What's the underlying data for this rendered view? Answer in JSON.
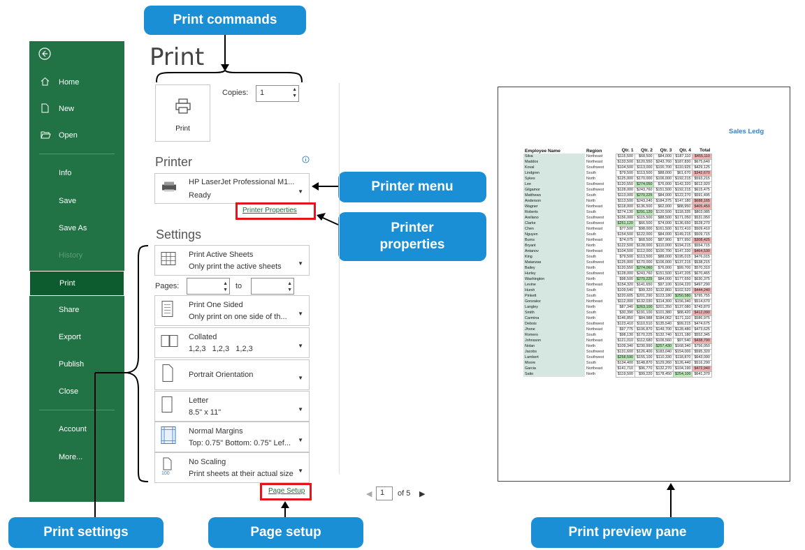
{
  "callouts": {
    "print_commands": "Print commands",
    "printer_menu": "Printer menu",
    "printer_properties": "Printer\nproperties",
    "print_settings": "Print settings",
    "page_setup": "Page setup",
    "print_preview_pane": "Print preview pane"
  },
  "sidebar": {
    "back_icon": "back-arrow-icon",
    "items": [
      {
        "label": "Home",
        "icon": "home-icon"
      },
      {
        "label": "New",
        "icon": "new-document-icon"
      },
      {
        "label": "Open",
        "icon": "open-folder-icon"
      },
      {
        "label": "Info"
      },
      {
        "label": "Save"
      },
      {
        "label": "Save As"
      },
      {
        "label": "History"
      },
      {
        "label": "Print"
      },
      {
        "label": "Share"
      },
      {
        "label": "Export"
      },
      {
        "label": "Publish"
      },
      {
        "label": "Close"
      },
      {
        "label": "Account"
      },
      {
        "label": "More..."
      }
    ],
    "selected": "Print"
  },
  "main": {
    "title": "Print",
    "print_button_label": "Print",
    "copies_label": "Copies:",
    "copies_value": "1"
  },
  "printer": {
    "section_title": "Printer",
    "name": "HP LaserJet Professional M1...",
    "status": "Ready",
    "properties_link": "Printer Properties"
  },
  "settings": {
    "section_title": "Settings",
    "what": {
      "t1": "Print Active Sheets",
      "t2": "Only print the active sheets"
    },
    "pages_label": "Pages:",
    "to_label": "to",
    "sided": {
      "t1": "Print One Sided",
      "t2": "Only print on one side of th..."
    },
    "collated": {
      "t1": "Collated",
      "t2": "1,2,3   1,2,3   1,2,3"
    },
    "orientation": {
      "t1": "Portrait Orientation"
    },
    "paper": {
      "t1": "Letter",
      "t2": "8.5\" x 11\""
    },
    "margins": {
      "t1": "Normal Margins",
      "t2": "Top: 0.75\" Bottom: 0.75\" Lef..."
    },
    "scaling": {
      "t1": "No Scaling",
      "t2": "Print sheets at their actual size",
      "icon_num": "100"
    },
    "page_setup_link": "Page Setup"
  },
  "preview": {
    "page_current": "1",
    "page_total": "of 5",
    "sheet_title": "Sales Ledg",
    "headers": [
      "Employee Name",
      "Region",
      "Qtr. 1",
      "Qtr. 2",
      "Qtr. 3",
      "Qtr. 4",
      "Total"
    ],
    "rows": [
      [
        "Silva",
        "Northeast",
        "$115,500",
        "$68,500",
        "$84,000",
        "$187,110",
        "$455,110"
      ],
      [
        "Maddox",
        "Northeast",
        "$133,500",
        "$120,550",
        "$243,760",
        "$187,830",
        "$675,640"
      ],
      [
        "Koval",
        "Southwest",
        "$104,500",
        "$113,000",
        "$100,700",
        "$110,925",
        "$429,125"
      ],
      [
        "Lindgren",
        "South",
        "$79,500",
        "$113,500",
        "$88,000",
        "$61,670",
        "$342,670"
      ],
      [
        "Sykes",
        "North",
        "$125,000",
        "$170,000",
        "$106,000",
        "$192,215",
        "$593,215"
      ],
      [
        "Lee",
        "Southwest",
        "$120,550",
        "$274,050",
        "$76,000",
        "$142,320",
        "$612,920"
      ],
      [
        "Gilgamor",
        "Southwest",
        "$128,000",
        "$243,760",
        "$151,500",
        "$192,215",
        "$615,475"
      ],
      [
        "Matthews",
        "South",
        "$113,000",
        "$270,225",
        "$84,000",
        "$122,270",
        "$591,495"
      ],
      [
        "Anderson",
        "North",
        "$113,500",
        "$243,240",
        "$184,375",
        "$147,180",
        "$688,165"
      ],
      [
        "Wagner",
        "Northeast",
        "$118,000",
        "$136,500",
        "$62,000",
        "$88,950",
        "$405,450"
      ],
      [
        "Roberts",
        "South",
        "$274,130",
        "$291,120",
        "$120,500",
        "$118,335",
        "$803,085"
      ],
      [
        "Arellano",
        "Southwest",
        "$156,000",
        "$115,500",
        "$88,500",
        "$171,050",
        "$531,050"
      ],
      [
        "Clarke",
        "Southwest",
        "$251,120",
        "$66,500",
        "$74,000",
        "$136,650",
        "$528,270"
      ],
      [
        "Chen",
        "Northeast",
        "$77,500",
        "$98,000",
        "$161,500",
        "$172,410",
        "$509,410"
      ],
      [
        "Nguyen",
        "South",
        "$154,500",
        "$122,000",
        "$84,000",
        "$149,215",
        "$509,715"
      ],
      [
        "Burns",
        "Northeast",
        "$74,075",
        "$68,500",
        "$87,900",
        "$77,950",
        "$308,425"
      ],
      [
        "Bryant",
        "North",
        "$122,500",
        "$128,000",
        "$110,000",
        "$194,215",
        "$554,715"
      ],
      [
        "Antanov",
        "Northeast",
        "$104,500",
        "$112,000",
        "$100,700",
        "$147,330",
        "$464,530"
      ],
      [
        "King",
        "South",
        "$79,500",
        "$113,500",
        "$88,000",
        "$195,015",
        "$476,015"
      ],
      [
        "Matanzas",
        "Southwest",
        "$125,000",
        "$170,000",
        "$106,000",
        "$137,215",
        "$538,215"
      ],
      [
        "Bailey",
        "North",
        "$120,550",
        "$274,060",
        "$76,000",
        "$99,700",
        "$570,310"
      ],
      [
        "Hurley",
        "Southwest",
        "$128,000",
        "$243,760",
        "$151,500",
        "$147,205",
        "$670,465"
      ],
      [
        "Washington",
        "North",
        "$98,500",
        "$270,225",
        "$84,000",
        "$177,650",
        "$630,375"
      ],
      [
        "Levine",
        "Northeast",
        "$154,320",
        "$141,650",
        "$97,100",
        "$104,220",
        "$497,290"
      ],
      [
        "Hursh",
        "South",
        "$109,540",
        "$99,320",
        "$132,860",
        "$102,520",
        "$444,240"
      ],
      [
        "Pinkett",
        "South",
        "$220,605",
        "$201,290",
        "$123,180",
        "$250,580",
        "$795,755"
      ],
      [
        "Gonzalez",
        "Northeast",
        "$112,000",
        "$132,030",
        "$114,300",
        "$156,340",
        "$514,670"
      ],
      [
        "Langley",
        "North",
        "$87,340",
        "$263,100",
        "$201,350",
        "$137,080",
        "$743,870"
      ],
      [
        "Smith",
        "South",
        "$30,390",
        "$191,100",
        "$101,380",
        "$88,420",
        "$412,090"
      ],
      [
        "Carmina",
        "North",
        "$146,850",
        "$84,988",
        "$184,062",
        "$171,110",
        "$586,975"
      ],
      [
        "Debois",
        "Southwest",
        "$123,410",
        "$110,510",
        "$135,540",
        "$99,215",
        "$474,675"
      ],
      [
        "Jhone",
        "Northeast",
        "$97,775",
        "$106,870",
        "$149,700",
        "$128,480",
        "$473,625"
      ],
      [
        "Romero",
        "South",
        "$98,130",
        "$170,225",
        "$132,740",
        "$121,180",
        "$552,345"
      ],
      [
        "Johnsson",
        "Northeast",
        "$121,010",
        "$112,680",
        "$106,560",
        "$97,540",
        "$438,790"
      ],
      [
        "Nolan",
        "North",
        "$109,340",
        "$230,990",
        "$257,430",
        "$168,340",
        "$756,050"
      ],
      [
        "Jacobs",
        "Southwest",
        "$131,600",
        "$126,400",
        "$183,040",
        "$154,000",
        "$595,320"
      ],
      [
        "Lambert",
        "Southwest",
        "$258,590",
        "$155,100",
        "$110,330",
        "$118,870",
        "$643,090"
      ],
      [
        "Moore",
        "South",
        "$134,400",
        "$148,870",
        "$129,260",
        "$126,440",
        "$516,290"
      ],
      [
        "Garcia",
        "Northeast",
        "$141,710",
        "$96,770",
        "$132,270",
        "$104,190",
        "$472,940"
      ],
      [
        "Saito",
        "North",
        "$119,500",
        "$99,220",
        "$178,450",
        "$254,100",
        "$641,370"
      ]
    ],
    "highlights": {
      "green": [
        [
          5,
          3
        ],
        [
          7,
          3
        ],
        [
          10,
          3
        ],
        [
          12,
          2
        ],
        [
          20,
          3
        ],
        [
          22,
          3
        ],
        [
          25,
          5
        ],
        [
          27,
          3
        ],
        [
          34,
          4
        ],
        [
          36,
          2
        ],
        [
          39,
          5
        ]
      ],
      "red": [
        [
          0,
          6
        ],
        [
          3,
          6
        ],
        [
          8,
          6
        ],
        [
          9,
          6
        ],
        [
          15,
          6
        ],
        [
          17,
          6
        ],
        [
          24,
          6
        ],
        [
          28,
          6
        ],
        [
          33,
          6
        ],
        [
          38,
          6
        ]
      ]
    }
  }
}
